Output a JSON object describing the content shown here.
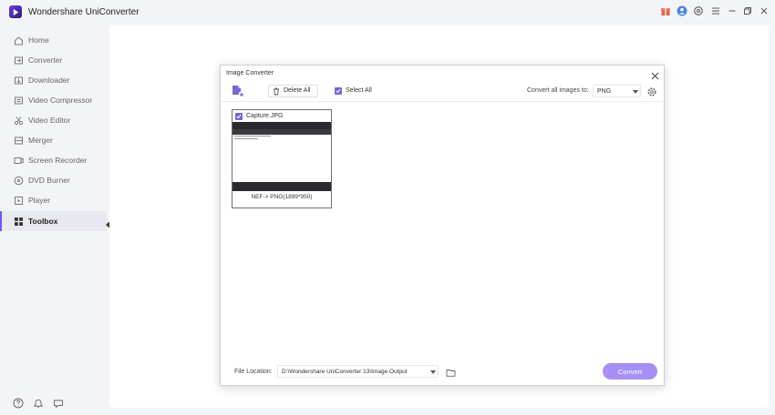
{
  "app": {
    "title": "Wondershare UniConverter"
  },
  "sidebar": {
    "items": [
      {
        "label": "Home",
        "icon": "home-icon",
        "active": false
      },
      {
        "label": "Converter",
        "icon": "converter-icon",
        "active": false
      },
      {
        "label": "Downloader",
        "icon": "download-icon",
        "active": false
      },
      {
        "label": "Video Compressor",
        "icon": "compress-icon",
        "active": false
      },
      {
        "label": "Video Editor",
        "icon": "scissors-icon",
        "active": false
      },
      {
        "label": "Merger",
        "icon": "merge-icon",
        "active": false
      },
      {
        "label": "Screen Recorder",
        "icon": "record-icon",
        "active": false
      },
      {
        "label": "DVD Burner",
        "icon": "disc-icon",
        "active": false
      },
      {
        "label": "Player",
        "icon": "play-icon",
        "active": false
      },
      {
        "label": "Toolbox",
        "icon": "grid-icon",
        "active": true
      }
    ]
  },
  "dialog": {
    "title": "Image Converter",
    "delete_all": "Delete All",
    "select_all": "Select All",
    "convert_all_label": "Convert all images to:",
    "format": "PNG",
    "card": {
      "name": "Capture.JPG",
      "info": "NEF-> PNG(1899*950)"
    },
    "file_location_label": "File Location:",
    "file_location": "D:\\Wondershare UniConverter 13\\Image Output",
    "convert": "Convert"
  },
  "colors": {
    "accent": "#7a67d6",
    "convert_button": "#a68ff5",
    "notification_badge": "#e8604c",
    "user_avatar": "#4a86e8"
  }
}
